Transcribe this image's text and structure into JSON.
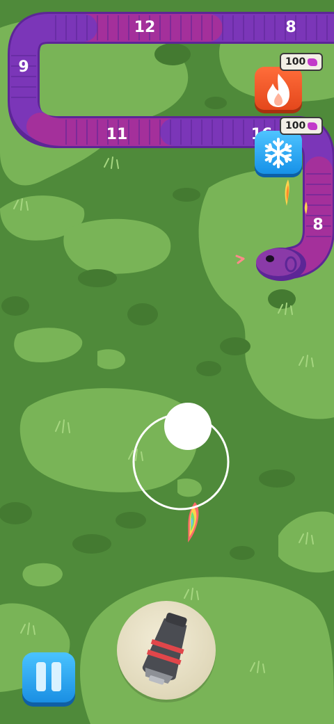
{
  "game": {
    "snake_segment_counts": [
      "12",
      "8",
      "9",
      "11",
      "16",
      "8"
    ],
    "powerups": [
      {
        "name": "fire",
        "cost": "100",
        "icon": "fire-icon",
        "color": "#e85424"
      },
      {
        "name": "freeze",
        "cost": "100",
        "icon": "snowflake-icon",
        "color": "#2aa7f2"
      }
    ],
    "colors": {
      "grass_dark": "#4f8a3a",
      "grass_light": "#79b457",
      "snake_purple": "#7b36b8",
      "snake_magenta": "#a4309b",
      "pause_button": "#2aa7f2"
    },
    "controls": {
      "pause_icon": "pause-icon",
      "cannon_icon": "cannon-icon"
    }
  }
}
